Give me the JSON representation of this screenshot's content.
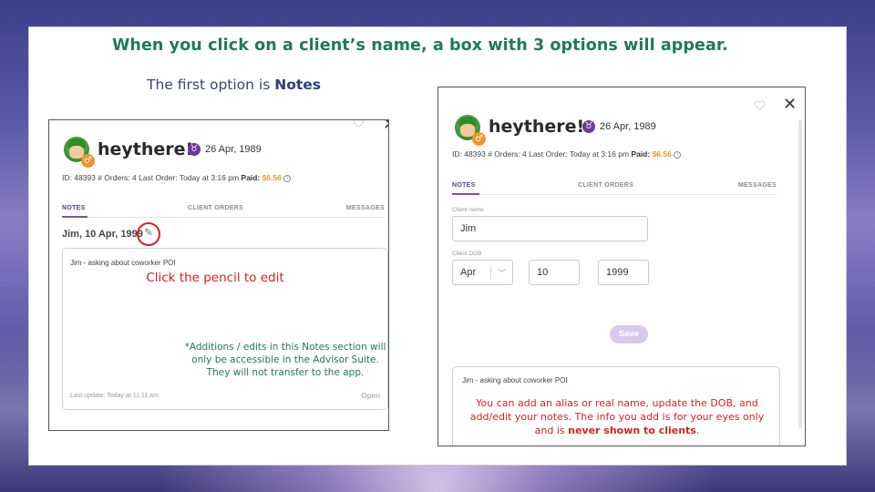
{
  "slide": {
    "headline": "When you click on a client’s name, a box with 3 options will appear.",
    "subhead_prefix": "The first option is ",
    "subhead_bold": "Notes"
  },
  "client": {
    "username": "heythere!",
    "zodiac_symbol": "♉",
    "dob": "26 Apr, 1989",
    "avatar_badge": "♂",
    "meta_text": "ID: 48393   # Orders: 4   Last Order: Today at 3:16 pm   ",
    "paid_label": "Paid: ",
    "paid_value": "$6.56"
  },
  "tabs": {
    "notes": "NOTES",
    "client_orders": "CLIENT ORDERS",
    "messages": "MESSAGES"
  },
  "left_panel": {
    "note_header": "Jim, 10 Apr, 1999",
    "note_text": "Jim - asking about coworker POI",
    "pencil_callout": "Click the pencil to edit",
    "green_callout_1": "*Additions / edits in this Notes section will",
    "green_callout_2": "only be accessible in the Advisor Suite.",
    "green_callout_3": "They will not transfer to the app.",
    "last_update": "Last update: Today at 11:11 am",
    "open_label": "Open"
  },
  "right_panel": {
    "client_name_label": "Client name",
    "client_name_value": "Jim",
    "client_dob_label": "Client DOB",
    "month_value": "Apr",
    "day_value": "10",
    "year_value": "1999",
    "save_label": "Save",
    "note_text": "Jim - asking about coworker POI",
    "callout_line_1": "You can add an alias or real name, update the DOB, and",
    "callout_line_2": "add/edit your notes. The info you add is for your eyes only",
    "callout_line_3_prefix": "and is ",
    "callout_line_3_bold": "never shown to clients",
    "callout_line_3_suffix": "."
  },
  "colors": {
    "headline_green": "#1f7a58",
    "accent_red": "#d6231f",
    "tab_purple": "#7b4fb8",
    "paid_orange": "#e59a1e"
  }
}
